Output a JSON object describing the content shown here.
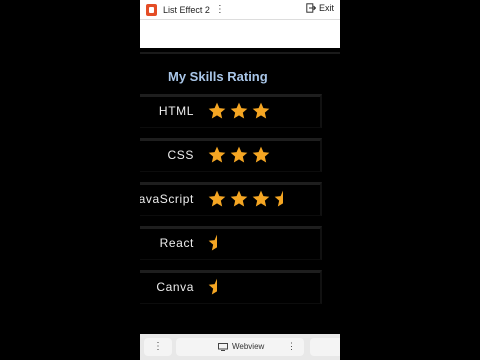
{
  "app": {
    "title": "List Effect 2",
    "menu_glyph": "⋮",
    "exit_label": "Exit"
  },
  "content": {
    "heading": "My Skills Rating",
    "skills": [
      {
        "label": "HTML",
        "rating": 3
      },
      {
        "label": "CSS",
        "rating": 3
      },
      {
        "label": "JavaScript",
        "rating": 3.5
      },
      {
        "label": "React",
        "rating": 0.5
      },
      {
        "label": "Canva",
        "rating": 0.5
      }
    ]
  },
  "bottombar": {
    "left_glyph": "⋮",
    "webview_label": "Webview",
    "menu_glyph": "⋮"
  },
  "colors": {
    "star": "#f5a623",
    "heading": "#a9c6e8"
  },
  "icons": {
    "logo": "html5-logo-icon",
    "exit": "exit-icon",
    "star": "star-icon",
    "half_star": "half-star-icon",
    "monitor": "monitor-icon"
  }
}
